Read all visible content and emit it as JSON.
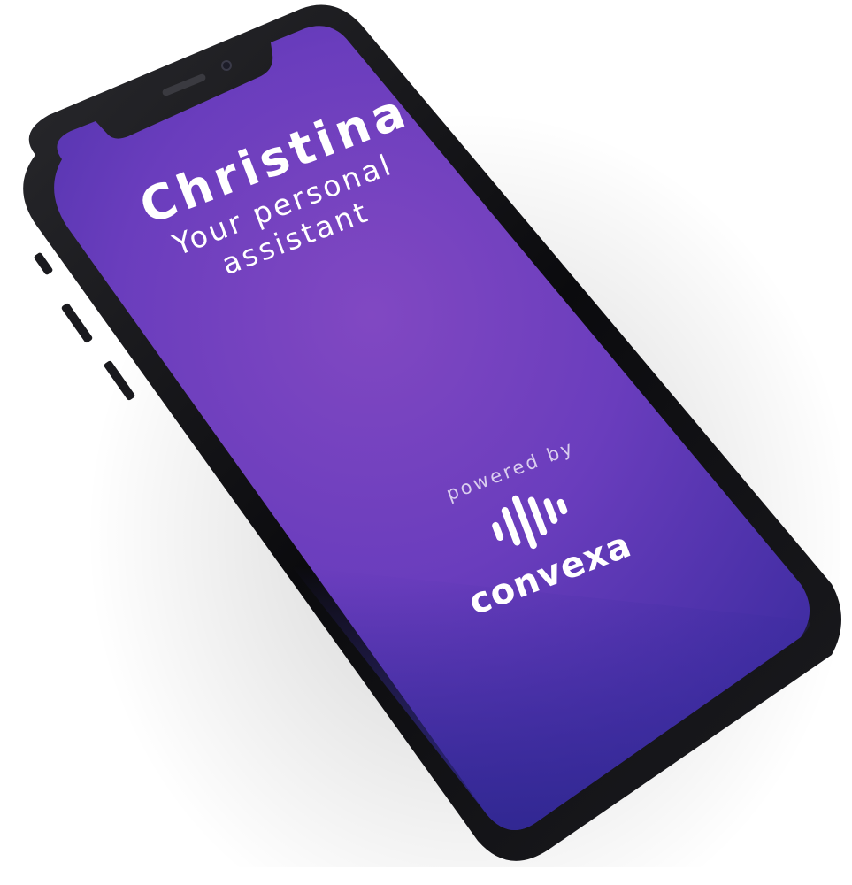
{
  "app": {
    "name": "Christina",
    "subtitle_line1": "Your personal",
    "subtitle_line2": "assistant"
  },
  "branding": {
    "powered_by": "powered by",
    "brand_name": "convexa",
    "logo_icon": "convexa-soundwave-logo-icon"
  },
  "colors": {
    "screen_top": "#6a3fc9",
    "screen_mid": "#7a45c2",
    "screen_bottom": "#3a2a9e",
    "phone_body": "#0d0d10",
    "text": "#ffffff"
  }
}
